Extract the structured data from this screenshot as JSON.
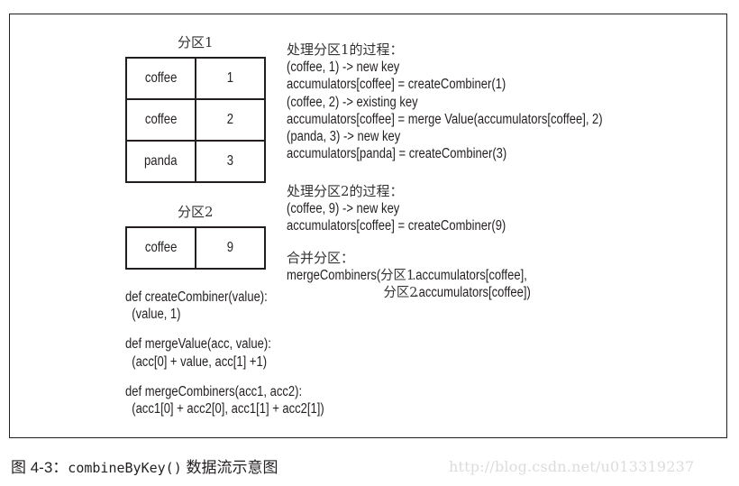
{
  "partition1": {
    "title": "分区1",
    "rows": [
      {
        "key": "coffee",
        "value": "1"
      },
      {
        "key": "coffee",
        "value": "2"
      },
      {
        "key": "panda",
        "value": "3"
      }
    ]
  },
  "partition2": {
    "title": "分区2",
    "rows": [
      {
        "key": "coffee",
        "value": "9"
      }
    ]
  },
  "functions": [
    {
      "def": "def createCombiner(value):",
      "body": "  (value, 1)"
    },
    {
      "def": "def mergeValue(acc, value):",
      "body": "  (acc[0] + value, acc[1] +1)"
    },
    {
      "def": "def mergeCombiners(acc1, acc2):",
      "body": "  (acc1[0] + acc2[0], acc1[1] + acc2[1])"
    }
  ],
  "process1": {
    "heading": "处理分区1的过程：",
    "lines": [
      "(coffee, 1) -> new key",
      "accumulators[coffee] = createCombiner(1)",
      "(coffee, 2) -> existing key",
      "accumulators[coffee] = merge Value(accumulators[coffee], 2)",
      "(panda, 3) -> new key",
      "accumulators[panda] = createCombiner(3)"
    ]
  },
  "process2": {
    "heading": "处理分区2的过程：",
    "lines": [
      "(coffee, 9) -> new key",
      "accumulators[coffee] = createCombiner(9)"
    ]
  },
  "merge": {
    "heading": "合并分区：",
    "line1_prefix": "mergeCombiners(",
    "line1_zh": "分区1",
    "line1_suffix": ".accumulators[coffee],",
    "line2_zh": "分区2",
    "line2_suffix": ".accumulators[coffee])"
  },
  "caption": {
    "prefix": "图 4-3：",
    "code": "combineByKey()",
    "suffix": " 数据流示意图"
  },
  "watermark": "http://blog.csdn.net/u013319237"
}
